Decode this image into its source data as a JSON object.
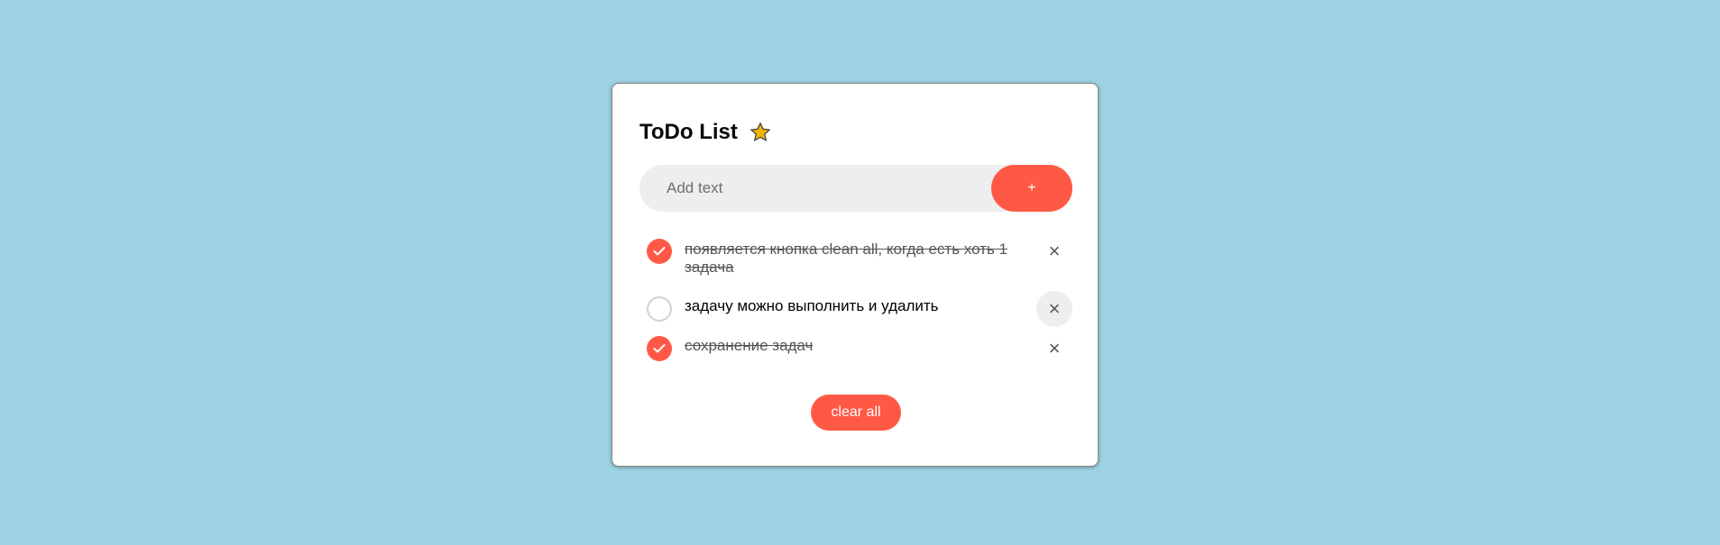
{
  "app": {
    "title": "ToDo List",
    "title_icon": "star-icon"
  },
  "input": {
    "placeholder": "Add text",
    "value": "",
    "add_button_label": "+"
  },
  "tasks": [
    {
      "text": "появляется кнопка clean all, когда есть хоть 1 задача",
      "done": true
    },
    {
      "text": "задачу можно выполнить и удалить",
      "done": false
    },
    {
      "text": "сохранение задач",
      "done": true
    }
  ],
  "delete_icon_glyph": "×",
  "clear_all_label": "clear all",
  "colors": {
    "background": "#9dd3e3",
    "accent": "#ff5945",
    "input_bg": "#edeef0",
    "star": "#f5b400"
  }
}
